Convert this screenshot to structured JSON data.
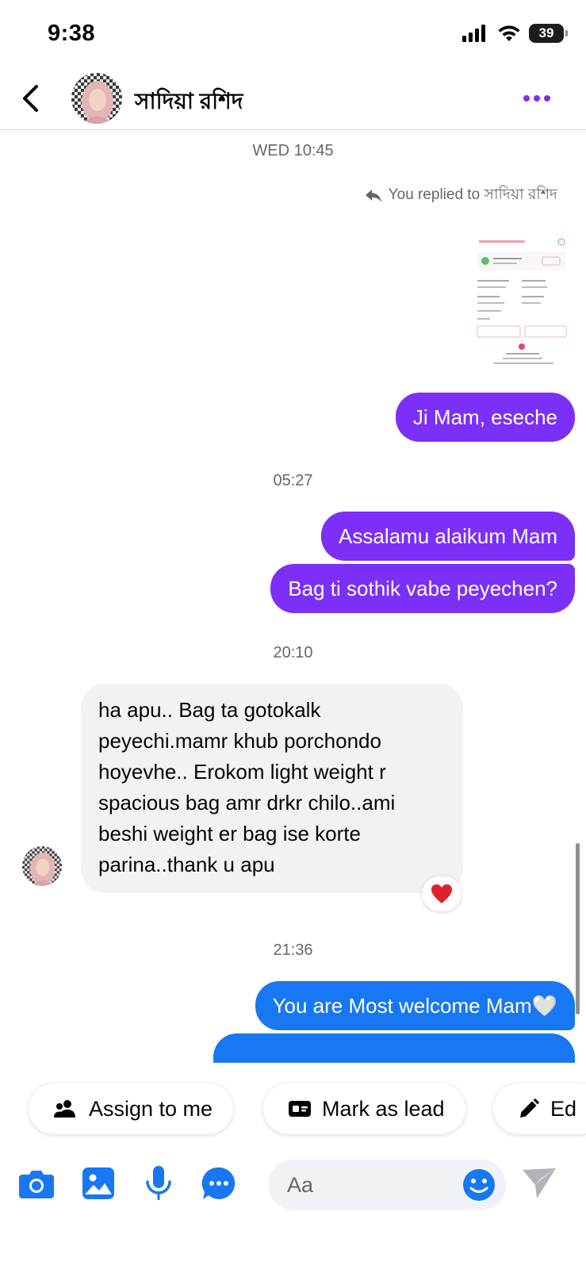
{
  "status_bar": {
    "time": "9:38",
    "battery": "39"
  },
  "header": {
    "contact_name": "সাদিয়া রশিদ"
  },
  "chat": {
    "timestamps": [
      "WED 10:45",
      "05:27",
      "20:10",
      "21:36"
    ],
    "reply_note": "You replied to সাদিয়া রশিদ",
    "messages": [
      {
        "direction": "outgoing",
        "text": "Ji Mam, eseche"
      },
      {
        "direction": "outgoing",
        "text": "Assalamu alaikum Mam"
      },
      {
        "direction": "outgoing",
        "text": "Bag ti sothik vabe peyechen?"
      },
      {
        "direction": "incoming",
        "text": "ha apu.. Bag ta gotokalk peyechi.mamr khub porchondo hoyevhe.. Erokom light weight r spacious bag amr drkr chilo..ami beshi weight er bag ise korte parina..thank u apu",
        "reaction": "red-heart"
      },
      {
        "direction": "outgoing",
        "text": "You are Most welcome Mam🤍"
      }
    ]
  },
  "quick_actions": [
    {
      "label": "Assign to me",
      "icon": "people-icon"
    },
    {
      "label": "Mark as lead",
      "icon": "id-card-icon"
    },
    {
      "label": "Ed",
      "icon": "pencil-icon"
    }
  ],
  "composer": {
    "placeholder": "Aa"
  },
  "colors": {
    "outgoing_purple": "#7b2ff7",
    "outgoing_blue": "#1877f2",
    "accent": "#1877f2",
    "incoming_bg": "#f0f2f5",
    "menu_dots": "#8b2be2"
  }
}
